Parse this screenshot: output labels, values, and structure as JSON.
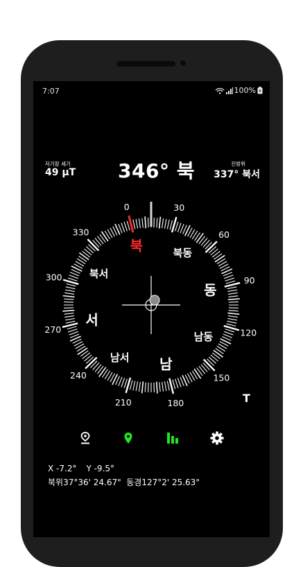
{
  "status": {
    "time": "7:07",
    "battery": "100%"
  },
  "readings": {
    "field_label": "자기장 세기",
    "field_value": "49 μT",
    "heading": "346° 북",
    "course_label": "진방위",
    "course_value": "337° 북서"
  },
  "compass": {
    "rotation_deg": -14,
    "degree_labels": [
      "330",
      "0",
      "30",
      "60",
      "90",
      "120",
      "150",
      "180",
      "210",
      "240",
      "270",
      "300"
    ],
    "cardinals": [
      "북",
      "동",
      "남",
      "서"
    ],
    "intercardinals": [
      "북동",
      "남동",
      "남서",
      "북서"
    ],
    "north_color": "#ff2a2a"
  },
  "true_north_mark": "T",
  "toolbar": {
    "icons": [
      "location-pin-icon",
      "map-marker-icon",
      "bar-chart-icon",
      "gear-icon"
    ],
    "active_color": "#22e622"
  },
  "coords": {
    "x": "X -7.2°",
    "y": "Y -9.5°",
    "latlon": "북위37°36' 24.67\"  동경127°2' 25.63\""
  }
}
